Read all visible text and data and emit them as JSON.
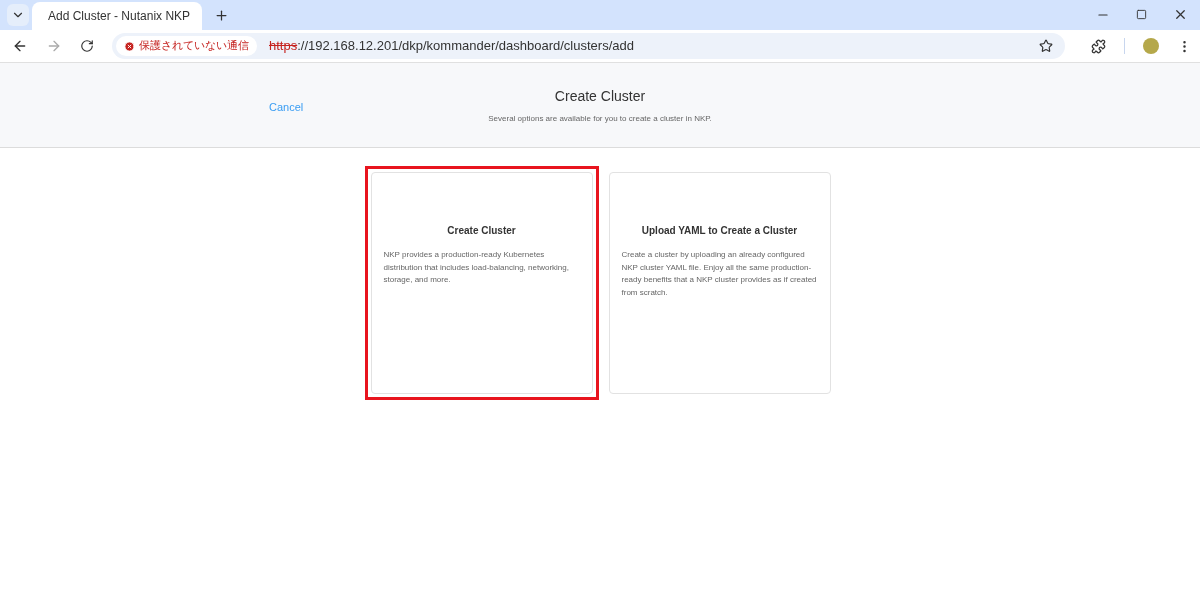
{
  "browser": {
    "tab": {
      "title": "Add Cluster - Nutanix NKP",
      "selected": true
    },
    "security_label": "保護されていない通信",
    "url": {
      "scheme": "https",
      "rest": "://192.168.12.201/dkp/kommander/dashboard/clusters/add",
      "insecure": true
    }
  },
  "header": {
    "cancel": "Cancel",
    "title": "Create Cluster",
    "subtitle": "Several options are available for you to create a cluster in NKP."
  },
  "options": [
    {
      "title": "Create Cluster",
      "description": "NKP provides a production-ready Kubernetes distribution that includes load-balancing, networking, storage, and more.",
      "highlighted": true
    },
    {
      "title": "Upload YAML to Create a Cluster",
      "description": "Create a cluster by uploading an already configured NKP cluster YAML file. Enjoy all the same production-ready benefits that a NKP cluster provides as if created from scratch.",
      "highlighted": false
    }
  ]
}
